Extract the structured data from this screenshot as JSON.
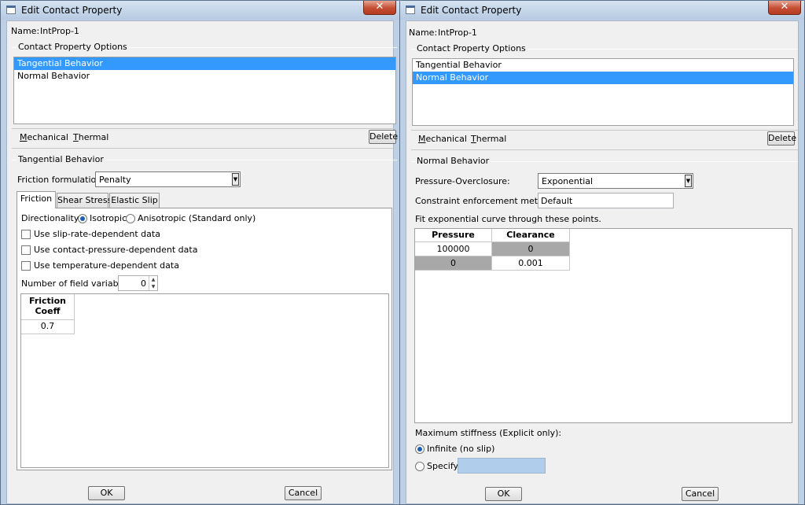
{
  "left": {
    "title": "Edit Contact Property",
    "name_label": "Name:",
    "name_value": "IntProp-1",
    "options_group": "Contact Property Options",
    "options": [
      "Tangential Behavior",
      "Normal Behavior"
    ],
    "menu": {
      "mechanical": "Mechanical",
      "thermal": "Thermal"
    },
    "delete": "Delete",
    "section_title": "Tangential Behavior",
    "friction_formulation_label": "Friction formulation:",
    "friction_formulation_value": "Penalty",
    "tabs": [
      "Friction",
      "Shear Stress",
      "Elastic Slip"
    ],
    "directionality_label": "Directionality:",
    "isotropic": "Isotropic",
    "anisotropic": "Anisotropic (Standard only)",
    "checkboxes": [
      "Use slip-rate-dependent data",
      "Use contact-pressure-dependent data",
      "Use temperature-dependent data"
    ],
    "field_vars_label": "Number of field variables:",
    "field_vars_value": "0",
    "table_header_1": "Friction",
    "table_header_2": "Coeff",
    "table_value": "0.7",
    "ok": "OK",
    "cancel": "Cancel"
  },
  "right": {
    "title": "Edit Contact Property",
    "name_label": "Name:",
    "name_value": "IntProp-1",
    "options_group": "Contact Property Options",
    "options": [
      "Tangential Behavior",
      "Normal Behavior"
    ],
    "menu": {
      "mechanical": "Mechanical",
      "thermal": "Thermal"
    },
    "delete": "Delete",
    "section_title": "Normal Behavior",
    "pressure_overclosure_label": "Pressure-Overclosure:",
    "pressure_overclosure_value": "Exponential",
    "constraint_label": "Constraint enforcement method:",
    "constraint_value": "Default",
    "fit_label": "Fit exponential curve through these points.",
    "col_pressure": "Pressure",
    "col_clearance": "Clearance",
    "rows": [
      [
        "100000",
        "0"
      ],
      [
        "0",
        "0.001"
      ]
    ],
    "max_stiffness_label": "Maximum stiffness (Explicit only):",
    "infinite": "Infinite (no slip)",
    "specify": "Specify:",
    "ok": "OK",
    "cancel": "Cancel"
  },
  "colors": {
    "selection": "#3399ff",
    "frame": "#bdd0e6",
    "gray_cell": "#a8a8a8",
    "specify_field": "#b0cdeb"
  }
}
